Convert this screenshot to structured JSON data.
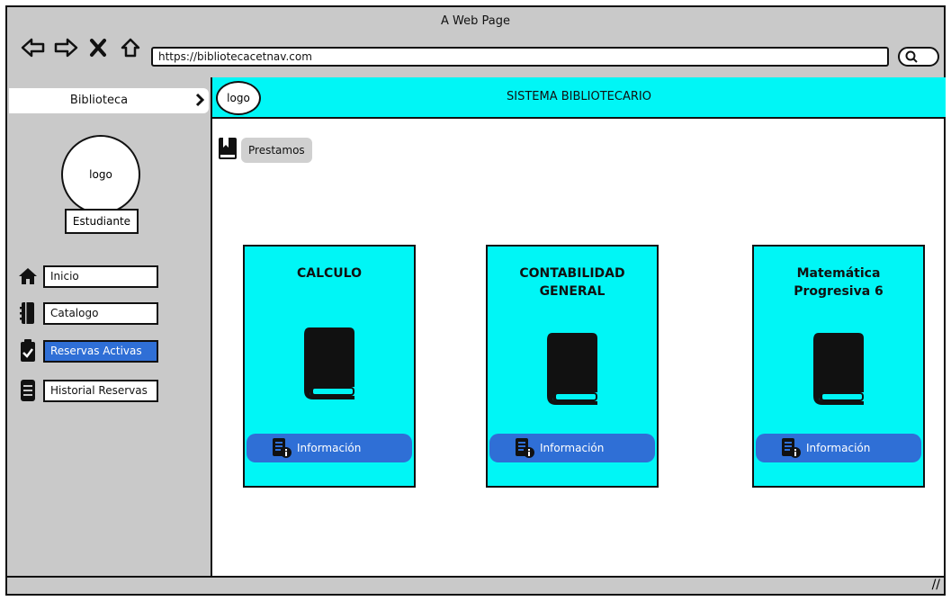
{
  "window": {
    "title": "A Web Page"
  },
  "browser": {
    "url": "https://bibliotecacetnav.com"
  },
  "sidebar": {
    "header": "Biblioteca",
    "avatar_label": "logo",
    "role": "Estudiante",
    "items": [
      {
        "label": "Inicio",
        "icon": "home-icon",
        "active": false
      },
      {
        "label": "Catalogo",
        "icon": "catalog-icon",
        "active": false
      },
      {
        "label": "Reservas Activas",
        "icon": "clipboard-check-icon",
        "active": true
      },
      {
        "label": "Historial Reservas",
        "icon": "document-icon",
        "active": false
      }
    ]
  },
  "header": {
    "logo": "logo",
    "title": "SISTEMA BIBLIOTECARIO"
  },
  "section": {
    "label": "Prestamos"
  },
  "cards": [
    {
      "title_line1": "CALCULO",
      "title_line2": "",
      "button": "Información"
    },
    {
      "title_line1": "CONTABILIDAD",
      "title_line2": "GENERAL",
      "button": "Información"
    },
    {
      "title_line1": "Matemática",
      "title_line2": "Progresiva 6",
      "button": "Información"
    }
  ],
  "colors": {
    "accent": "#00f6f6",
    "button": "#2f6fd6",
    "chrome": "#c9c9c9"
  }
}
